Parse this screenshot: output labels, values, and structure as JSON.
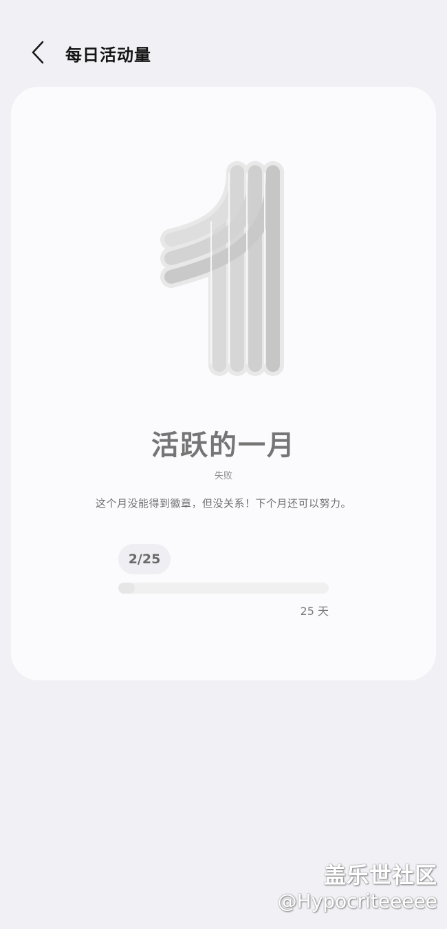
{
  "header": {
    "title": "每日活动量"
  },
  "badge": {
    "title": "活跃的一月",
    "status": "失败",
    "description": "这个月没能得到徽章，但没关系！下个月还可以努力。",
    "icon": "number-one-badge-icon"
  },
  "progress": {
    "label": "2/25",
    "current": 2,
    "goal": 25,
    "target_label": "25 天"
  },
  "watermark": {
    "site": "盖乐世社区",
    "user": "@Hypocriteeeee"
  },
  "colors": {
    "background": "#f1f0f5",
    "card": "#fbfbfd",
    "badge_gray": "#cfcfcf"
  }
}
